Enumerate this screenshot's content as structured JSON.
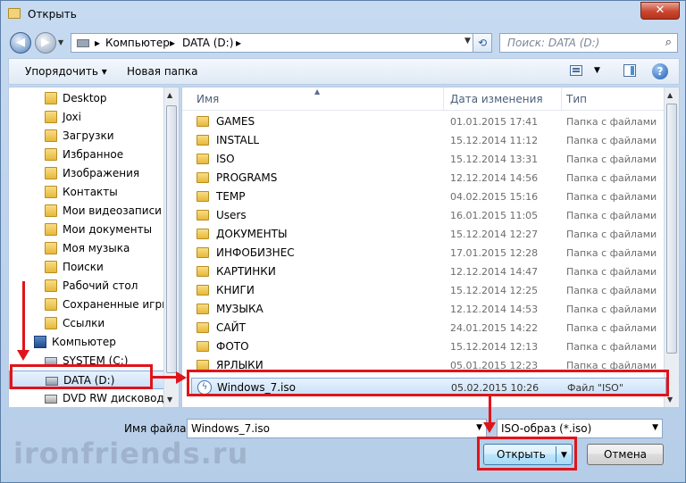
{
  "window": {
    "title": "Открыть",
    "close_label": "✕"
  },
  "nav": {
    "back_label": "◀",
    "forward_label": "▶",
    "history_label": "▼",
    "breadcrumb": [
      "Компьютер",
      "DATA (D:)"
    ],
    "separator": "▸",
    "refresh_label": "⟲",
    "search_placeholder": "Поиск: DATA (D:)",
    "search_icon": "⌕"
  },
  "toolbar": {
    "organize_label": "Упорядочить ▾",
    "new_folder_label": "Новая папка",
    "view_dropdown": "▼",
    "help_label": "?"
  },
  "tree": {
    "items": [
      {
        "label": "Desktop",
        "icon": "folder-icon"
      },
      {
        "label": "Joxi",
        "icon": "folder-icon"
      },
      {
        "label": "Загрузки",
        "icon": "folder-icon"
      },
      {
        "label": "Избранное",
        "icon": "folder-icon"
      },
      {
        "label": "Изображения",
        "icon": "folder-icon"
      },
      {
        "label": "Контакты",
        "icon": "folder-icon"
      },
      {
        "label": "Мои видеозаписи",
        "icon": "folder-icon"
      },
      {
        "label": "Мои документы",
        "icon": "folder-icon"
      },
      {
        "label": "Моя музыка",
        "icon": "folder-icon"
      },
      {
        "label": "Поиски",
        "icon": "folder-icon"
      },
      {
        "label": "Рабочий стол",
        "icon": "folder-icon"
      },
      {
        "label": "Сохраненные игры",
        "icon": "folder-icon"
      },
      {
        "label": "Ссылки",
        "icon": "folder-icon"
      },
      {
        "label": "Компьютер",
        "icon": "computer-icon"
      },
      {
        "label": "SYSTEM (C:)",
        "icon": "drive-icon"
      },
      {
        "label": "DATA (D:)",
        "icon": "drive-icon",
        "selected": true
      },
      {
        "label": "DVD RW дисковод (E:",
        "icon": "dvd-icon"
      }
    ]
  },
  "files": {
    "columns": {
      "name": "Имя",
      "date": "Дата изменения",
      "type": "Тип"
    },
    "rows": [
      {
        "name": "GAMES",
        "date": "01.01.2015 17:41",
        "type": "Папка с файлами"
      },
      {
        "name": "INSTALL",
        "date": "15.12.2014 11:12",
        "type": "Папка с файлами"
      },
      {
        "name": "ISO",
        "date": "15.12.2014 13:31",
        "type": "Папка с файлами"
      },
      {
        "name": "PROGRAMS",
        "date": "12.12.2014 14:56",
        "type": "Папка с файлами"
      },
      {
        "name": "TEMP",
        "date": "04.02.2015 15:16",
        "type": "Папка с файлами"
      },
      {
        "name": "Users",
        "date": "16.01.2015 11:05",
        "type": "Папка с файлами"
      },
      {
        "name": "ДОКУМЕНТЫ",
        "date": "15.12.2014 12:27",
        "type": "Папка с файлами"
      },
      {
        "name": "ИНФОБИЗНЕС",
        "date": "17.01.2015 12:28",
        "type": "Папка с файлами"
      },
      {
        "name": "КАРТИНКИ",
        "date": "12.12.2014 14:47",
        "type": "Папка с файлами"
      },
      {
        "name": "КНИГИ",
        "date": "15.12.2014 12:25",
        "type": "Папка с файлами"
      },
      {
        "name": "МУЗЫКА",
        "date": "12.12.2014 14:53",
        "type": "Папка с файлами"
      },
      {
        "name": "САЙТ",
        "date": "24.01.2015 14:22",
        "type": "Папка с файлами"
      },
      {
        "name": "ФОТО",
        "date": "15.12.2014 12:13",
        "type": "Папка с файлами"
      },
      {
        "name": "ЯРЛЫКИ",
        "date": "05.01.2015 12:23",
        "type": "Папка с файлами"
      },
      {
        "name": "Windows_7.iso",
        "date": "05.02.2015 10:26",
        "type": "Файл \"ISO\"",
        "selected": true
      }
    ]
  },
  "bottom": {
    "filename_label": "Имя файла:",
    "filename_value": "Windows_7.iso",
    "filetype_value": "ISO-образ (*.iso)",
    "open_label": "Открыть",
    "cancel_label": "Отмена",
    "dropdown": "▼"
  },
  "watermark": "ironfriends.ru",
  "colors": {
    "highlight": "#e0141a",
    "selection": "#c9e0f8",
    "window": "#c6daf0"
  }
}
